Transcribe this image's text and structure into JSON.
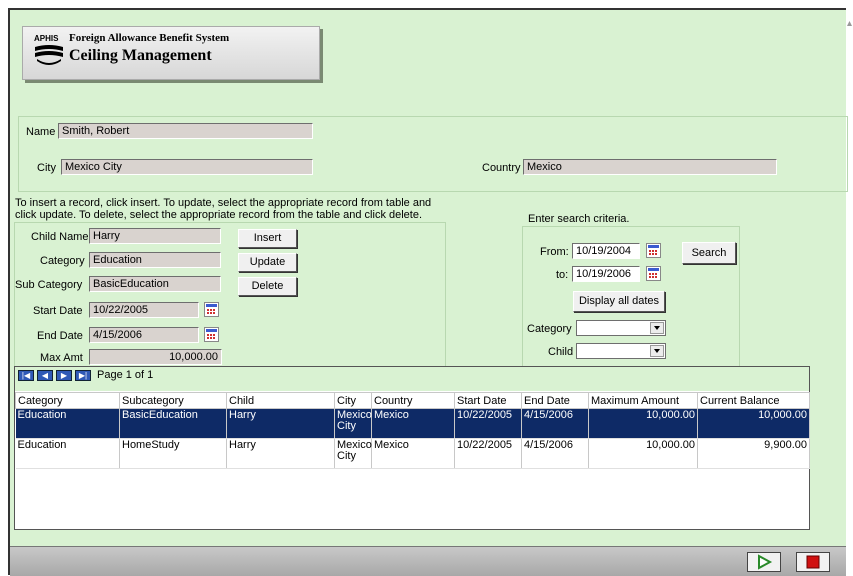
{
  "header": {
    "agency": "APHIS",
    "system_name": "Foreign Allowance Benefit System",
    "page_title": "Ceiling Management"
  },
  "person": {
    "name_label": "Name",
    "name_value": "Smith, Robert",
    "city_label": "City",
    "city_value": "Mexico City",
    "country_label": "Country",
    "country_value": "Mexico"
  },
  "instructions": [
    "To insert a record, click insert. To update, select the appropriate record from table and",
    "click update. To delete, select the appropriate record from the table and click delete."
  ],
  "record": {
    "child_name_label": "Child Name",
    "child_name_value": "Harry",
    "category_label": "Category",
    "category_value": "Education",
    "sub_category_label": "Sub Category",
    "sub_category_value": "BasicEducation",
    "start_date_label": "Start Date",
    "start_date_value": "10/22/2005",
    "end_date_label": "End Date",
    "end_date_value": "4/15/2006",
    "max_amt_label": "Max Amt",
    "max_amt_value": "10,000.00",
    "insert_label": "Insert",
    "update_label": "Update",
    "delete_label": "Delete"
  },
  "search": {
    "heading": "Enter search criteria.",
    "from_label": "From:",
    "from_value": "10/19/2004",
    "to_label": "to:",
    "to_value": "10/19/2006",
    "search_label": "Search",
    "display_all_label": "Display all dates",
    "category_label": "Category",
    "category_value": "",
    "child_label": "Child",
    "child_value": ""
  },
  "grid": {
    "page_text": "Page 1 of 1",
    "columns": [
      "Category",
      "Subcategory",
      "Child",
      "City",
      "Country",
      "Start Date",
      "End Date",
      "Maximum Amount",
      "Current Balance"
    ],
    "rows": [
      [
        "Education",
        "BasicEducation",
        "Harry",
        "Mexico City",
        "Mexico",
        "10/22/2005",
        "4/15/2006",
        "10,000.00",
        "10,000.00"
      ],
      [
        "Education",
        "HomeStudy",
        "Harry",
        "Mexico City",
        "Mexico",
        "10/22/2005",
        "4/15/2006",
        "10,000.00",
        "9,900.00"
      ]
    ],
    "selected_row": 0
  },
  "icons": {
    "first": "first-page-icon",
    "prev": "prev-page-icon",
    "next": "next-page-icon",
    "last": "last-page-icon",
    "calendar": "calendar-icon",
    "play": "play-icon",
    "stop": "stop-icon"
  },
  "colors": {
    "background": "#d9f2d2",
    "selected_row": "#0e2a66",
    "nav_buttons": "#2f59b6"
  }
}
